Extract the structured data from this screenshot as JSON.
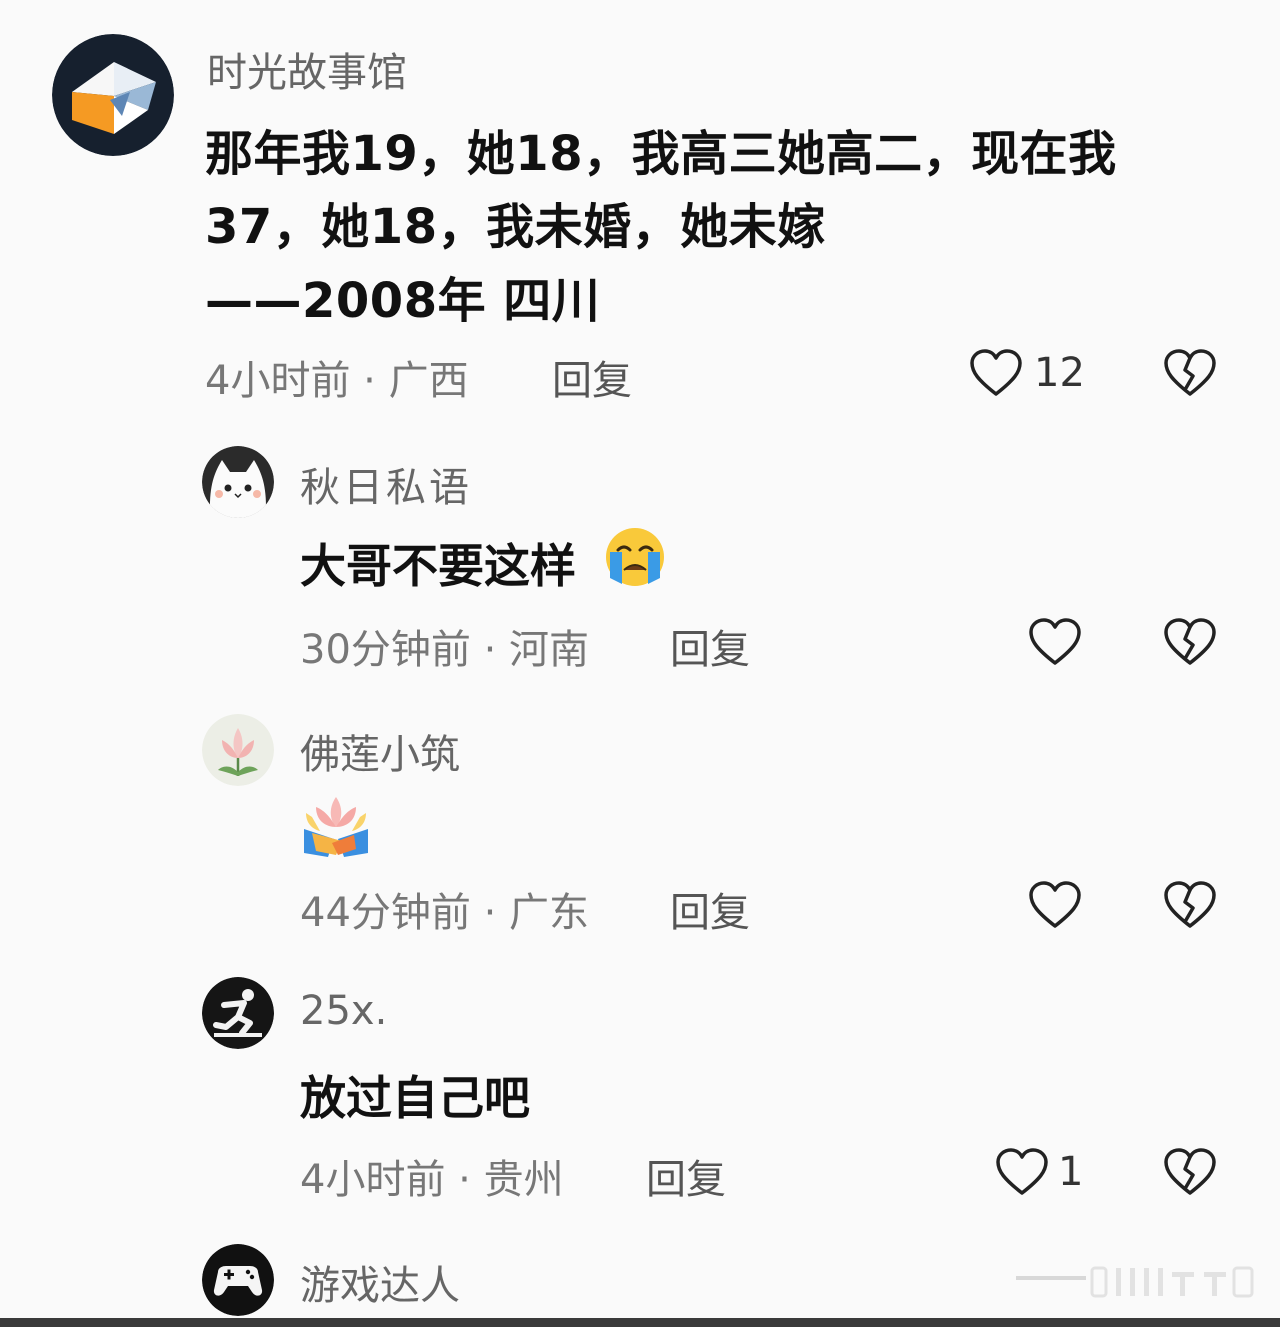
{
  "comments": [
    {
      "username": "时光故事馆",
      "content_lines": [
        "那年我19，她18，我高三她高二，现在我",
        "37，她18，我未婚，她未嫁",
        "——2008年 四川"
      ],
      "meta": "4小时前 · 广西",
      "reply_label": "回复",
      "like_count": "12",
      "avatar_icon": "play-logo-avatar"
    },
    {
      "username": "秋日私语",
      "content": "大哥不要这样",
      "emoji": "loudly-crying-face-emoji",
      "meta": "30分钟前 · 河南",
      "reply_label": "回复",
      "avatar_icon": "cat-face-avatar"
    },
    {
      "username": "佛莲小筑",
      "emoji": "lotus-hands-emoji",
      "meta": "44分钟前 · 广东",
      "reply_label": "回复",
      "avatar_icon": "lotus-avatar"
    },
    {
      "username": "25x.",
      "content": "放过自己吧",
      "meta": "4小时前 · 贵州",
      "reply_label": "回复",
      "like_count": "1",
      "avatar_icon": "runner-avatar"
    },
    {
      "username": "游戏达人",
      "avatar_icon": "gamepad-avatar"
    }
  ],
  "colors": {
    "background": "#fafafa",
    "text_primary": "#111111",
    "text_secondary": "#777777",
    "icon_stroke": "#222222"
  }
}
